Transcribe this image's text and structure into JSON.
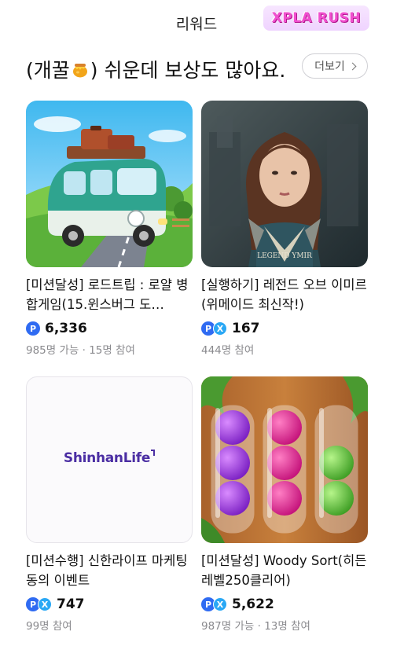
{
  "header": {
    "title": "리워드",
    "badge_text": "XPLA RUSH"
  },
  "section": {
    "title_before": "(개꿀",
    "title_icon": "honey-pot-icon",
    "title_after": ") 쉬운데 보상도 많아요.",
    "more_label": "더보기"
  },
  "cards": [
    {
      "title": "[미션달성] 로드트립 : 로얄 병합게임(15.윈스버그 도…",
      "reward_icons": [
        "point-icon"
      ],
      "reward": "6,336",
      "participants": "985명 가능 · 15명 참여",
      "thumb": "road-trip-van-art"
    },
    {
      "title": "[실행하기] 레전드 오브 이미르 (위메이드 최신작!)",
      "reward_icons": [
        "point-icon",
        "xpla-icon"
      ],
      "reward": "167",
      "participants": "444명 참여",
      "thumb": "legend-of-ymir-art",
      "thumb_logo_text": "LEGEND YMIR"
    },
    {
      "title": "[미션수행] 신한라이프 마케팅동의 이벤트",
      "reward_icons": [
        "point-icon",
        "xpla-icon"
      ],
      "reward": "747",
      "participants": "99명 참여",
      "thumb": "shinhanlife-logo",
      "thumb_logo_text": "ShinhanLife"
    },
    {
      "title": "[미션달성] Woody Sort(히든레벨250클리어)",
      "reward_icons": [
        "point-icon",
        "xpla-icon"
      ],
      "reward": "5,622",
      "participants": "987명 가능 · 13명 참여",
      "thumb": "woody-sort-tubes-art"
    }
  ],
  "colors": {
    "point_blue": "#2f6bf2",
    "xpla_blue": "#2aa8f5",
    "muted_text": "#8a8a8e",
    "badge_pink": "#f04fcf"
  }
}
